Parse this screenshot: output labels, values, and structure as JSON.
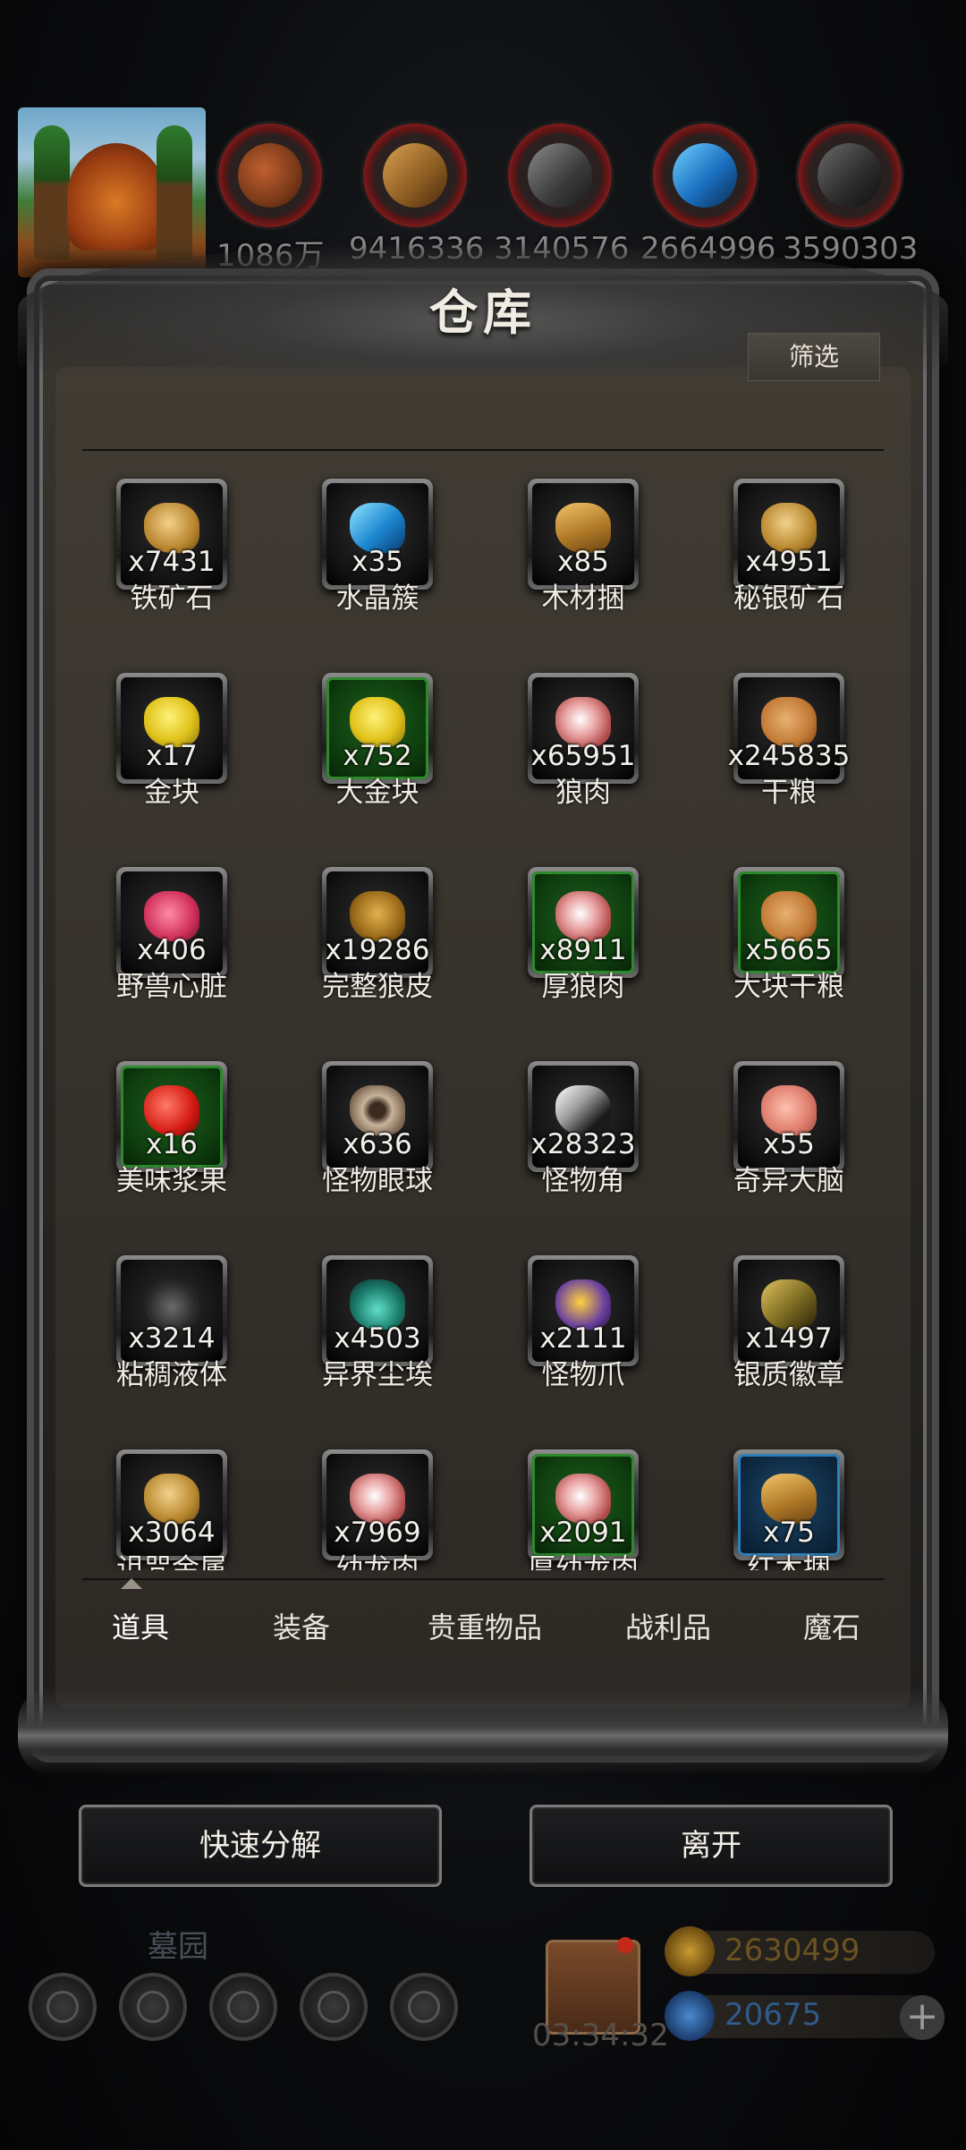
{
  "resources": [
    "1086万",
    "9416336",
    "3140576",
    "2664996",
    "3590303"
  ],
  "title": "仓库",
  "filter_label": "筛选",
  "items": [
    {
      "qty": "x7431",
      "name": "铁矿石",
      "icon": "iron-ore-icon",
      "rarity": "normal"
    },
    {
      "qty": "x35",
      "name": "水晶簇",
      "icon": "crystal-cluster-icon",
      "rarity": "normal"
    },
    {
      "qty": "x85",
      "name": "木材捆",
      "icon": "wood-bundle-icon",
      "rarity": "normal"
    },
    {
      "qty": "x4951",
      "name": "秘银矿石",
      "icon": "mithril-ore-icon",
      "rarity": "normal"
    },
    {
      "qty": "x17",
      "name": "金块",
      "icon": "gold-nugget-icon",
      "rarity": "normal"
    },
    {
      "qty": "x752",
      "name": "大金块",
      "icon": "large-gold-nugget-icon",
      "rarity": "green"
    },
    {
      "qty": "x65951",
      "name": "狼肉",
      "icon": "wolf-meat-icon",
      "rarity": "normal"
    },
    {
      "qty": "x245835",
      "name": "干粮",
      "icon": "dry-ration-icon",
      "rarity": "normal"
    },
    {
      "qty": "x406",
      "name": "野兽心脏",
      "icon": "beast-heart-icon",
      "rarity": "normal"
    },
    {
      "qty": "x19286",
      "name": "完整狼皮",
      "icon": "wolf-pelt-icon",
      "rarity": "normal"
    },
    {
      "qty": "x8911",
      "name": "厚狼肉",
      "icon": "thick-wolf-meat-icon",
      "rarity": "green"
    },
    {
      "qty": "x5665",
      "name": "大块干粮",
      "icon": "large-dry-ration-icon",
      "rarity": "green"
    },
    {
      "qty": "x16",
      "name": "美味浆果",
      "icon": "berry-icon",
      "rarity": "green"
    },
    {
      "qty": "x636",
      "name": "怪物眼球",
      "icon": "eyeball-icon",
      "rarity": "normal"
    },
    {
      "qty": "x28323",
      "name": "怪物角",
      "icon": "horn-icon",
      "rarity": "normal"
    },
    {
      "qty": "x55",
      "name": "奇异大脑",
      "icon": "brain-icon",
      "rarity": "normal"
    },
    {
      "qty": "x3214",
      "name": "粘稠液体",
      "icon": "viscous-liquid-icon",
      "rarity": "normal"
    },
    {
      "qty": "x4503",
      "name": "异界尘埃",
      "icon": "otherworld-dust-icon",
      "rarity": "normal"
    },
    {
      "qty": "x2111",
      "name": "怪物爪",
      "icon": "claw-icon",
      "rarity": "normal"
    },
    {
      "qty": "x1497",
      "name": "银质徽章",
      "icon": "silver-badge-icon",
      "rarity": "normal"
    },
    {
      "qty": "x3064",
      "name": "诅咒金属",
      "icon": "cursed-metal-icon",
      "rarity": "normal"
    },
    {
      "qty": "x7969",
      "name": "幼龙肉",
      "icon": "young-dragon-meat-icon",
      "rarity": "normal"
    },
    {
      "qty": "x2091",
      "name": "厚幼龙肉",
      "icon": "thick-young-dragon-meat-icon",
      "rarity": "green"
    },
    {
      "qty": "x75",
      "name": "红木捆",
      "icon": "redwood-bundle-icon",
      "rarity": "blue"
    }
  ],
  "tabs": [
    "道具",
    "装备",
    "贵重物品",
    "战利品",
    "魔石"
  ],
  "actions": {
    "decompose": "快速分解",
    "leave": "离开"
  },
  "hud": {
    "location": "墓园",
    "timer": "03:34:32",
    "gold": "2630499",
    "gems": "20675",
    "plus": "+"
  },
  "colors": {
    "gold": "#b48a2a",
    "gems": "#3a7fc0"
  }
}
